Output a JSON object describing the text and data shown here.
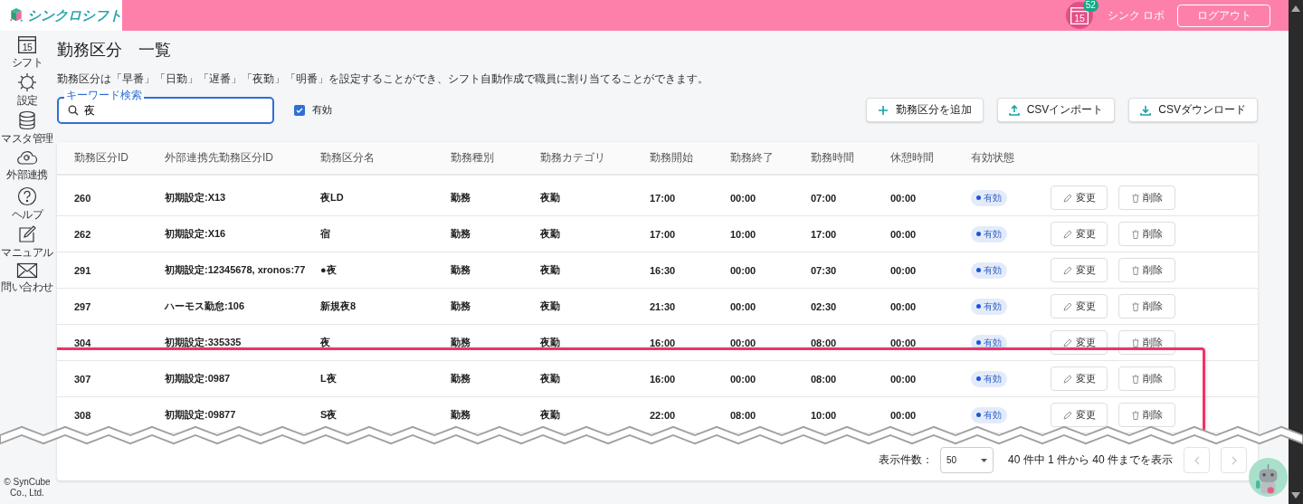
{
  "header": {
    "app_name": "シンクロシフト",
    "notification_day": "15",
    "notification_count": "52",
    "user_name": "シンク ロボ",
    "logout": "ログアウト"
  },
  "sidebar": {
    "items": [
      {
        "kind": "calendar",
        "label": "シフト",
        "day": "15"
      },
      {
        "kind": "gear",
        "label": "設定"
      },
      {
        "kind": "database",
        "label": "マスタ管理"
      },
      {
        "kind": "cloud",
        "label": "外部連携"
      },
      {
        "kind": "help",
        "label": "ヘルプ"
      },
      {
        "kind": "edit",
        "label": "マニュアル"
      },
      {
        "kind": "mail",
        "label": "問い合わせ"
      }
    ],
    "copyright": "© SynCube Co., Ltd."
  },
  "page": {
    "title": "勤務区分　一覧",
    "description": "勤務区分は「早番」「日勤」「遅番」「夜勤」「明番」を設定することができ、シフト自動作成で職員に割り当てることができます。"
  },
  "search": {
    "label": "キーワード検索",
    "value": "夜"
  },
  "active_filter": {
    "label": "有効",
    "checked": true
  },
  "actions": [
    {
      "kind": "add",
      "label": "勤務区分を追加"
    },
    {
      "kind": "upload",
      "label": "CSVインポート"
    },
    {
      "kind": "download",
      "label": "CSVダウンロード"
    }
  ],
  "table": {
    "columns": [
      "勤務区分ID",
      "外部連携先勤務区分ID",
      "勤務区分名",
      "勤務種別",
      "勤務カテゴリ",
      "勤務開始",
      "勤務終了",
      "勤務時間",
      "休憩時間",
      "有効状態"
    ],
    "rows": [
      {
        "id": "260",
        "external_id": "初期設定:X13",
        "name": "夜LD",
        "type": "勤務",
        "category": "夜勤",
        "start": "17:00",
        "end": "00:00",
        "duration": "07:00",
        "break": "00:00",
        "status": "有効",
        "active": true,
        "edit": "変更",
        "delete": "削除",
        "highlighted": false
      },
      {
        "id": "262",
        "external_id": "初期設定:X16",
        "name": "宿",
        "type": "勤務",
        "category": "夜勤",
        "start": "17:00",
        "end": "10:00",
        "duration": "17:00",
        "break": "00:00",
        "status": "有効",
        "active": true,
        "edit": "変更",
        "delete": "削除",
        "highlighted": false
      },
      {
        "id": "291",
        "external_id": "初期設定:12345678, xronos:77",
        "name": "●夜",
        "type": "勤務",
        "category": "夜勤",
        "start": "16:30",
        "end": "00:00",
        "duration": "07:30",
        "break": "00:00",
        "status": "有効",
        "active": true,
        "edit": "変更",
        "delete": "削除",
        "highlighted": false
      },
      {
        "id": "297",
        "external_id": "ハーモス勤怠:106",
        "name": "新規夜8",
        "type": "勤務",
        "category": "夜勤",
        "start": "21:30",
        "end": "00:00",
        "duration": "02:30",
        "break": "00:00",
        "status": "有効",
        "active": true,
        "edit": "変更",
        "delete": "削除",
        "highlighted": false
      },
      {
        "id": "304",
        "external_id": "初期設定:335335",
        "name": "夜",
        "type": "勤務",
        "category": "夜勤",
        "start": "16:00",
        "end": "00:00",
        "duration": "08:00",
        "break": "00:00",
        "status": "有効",
        "active": true,
        "edit": "変更",
        "delete": "削除",
        "highlighted": false
      },
      {
        "id": "307",
        "external_id": "初期設定:0987",
        "name": "L夜",
        "type": "勤務",
        "category": "夜勤",
        "start": "16:00",
        "end": "00:00",
        "duration": "08:00",
        "break": "00:00",
        "status": "有効",
        "active": true,
        "edit": "変更",
        "delete": "削除",
        "highlighted": true
      },
      {
        "id": "308",
        "external_id": "初期設定:09877",
        "name": "S夜",
        "type": "勤務",
        "category": "夜勤",
        "start": "22:00",
        "end": "08:00",
        "duration": "10:00",
        "break": "00:00",
        "status": "有効",
        "active": true,
        "edit": "変更",
        "delete": "削除",
        "highlighted": true
      }
    ]
  },
  "pagination": {
    "page_size_label": "表示件数：",
    "page_size": "50",
    "summary": "40 件中 1 件から 40 件までを表示",
    "prev_disabled": true,
    "next_disabled": true
  }
}
